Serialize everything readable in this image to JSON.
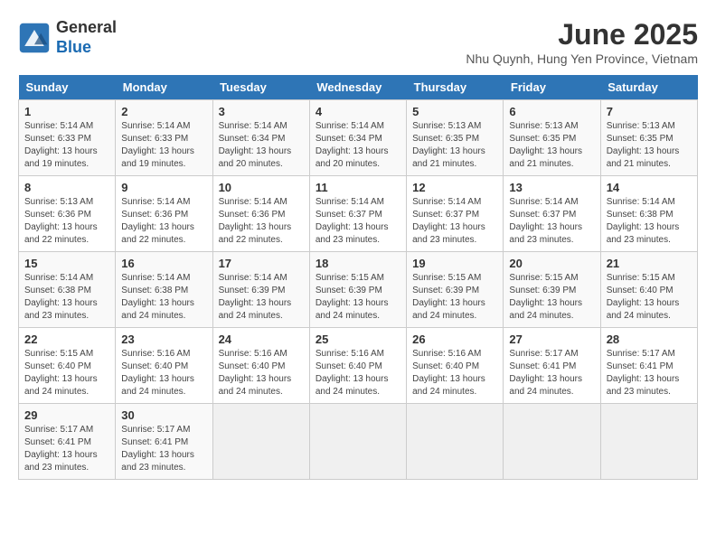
{
  "header": {
    "logo_line1": "General",
    "logo_line2": "Blue",
    "month_year": "June 2025",
    "location": "Nhu Quynh, Hung Yen Province, Vietnam"
  },
  "days_of_week": [
    "Sunday",
    "Monday",
    "Tuesday",
    "Wednesday",
    "Thursday",
    "Friday",
    "Saturday"
  ],
  "weeks": [
    [
      {
        "day": 1,
        "lines": [
          "Sunrise: 5:14 AM",
          "Sunset: 6:33 PM",
          "Daylight: 13 hours",
          "and 19 minutes."
        ]
      },
      {
        "day": 2,
        "lines": [
          "Sunrise: 5:14 AM",
          "Sunset: 6:33 PM",
          "Daylight: 13 hours",
          "and 19 minutes."
        ]
      },
      {
        "day": 3,
        "lines": [
          "Sunrise: 5:14 AM",
          "Sunset: 6:34 PM",
          "Daylight: 13 hours",
          "and 20 minutes."
        ]
      },
      {
        "day": 4,
        "lines": [
          "Sunrise: 5:14 AM",
          "Sunset: 6:34 PM",
          "Daylight: 13 hours",
          "and 20 minutes."
        ]
      },
      {
        "day": 5,
        "lines": [
          "Sunrise: 5:13 AM",
          "Sunset: 6:35 PM",
          "Daylight: 13 hours",
          "and 21 minutes."
        ]
      },
      {
        "day": 6,
        "lines": [
          "Sunrise: 5:13 AM",
          "Sunset: 6:35 PM",
          "Daylight: 13 hours",
          "and 21 minutes."
        ]
      },
      {
        "day": 7,
        "lines": [
          "Sunrise: 5:13 AM",
          "Sunset: 6:35 PM",
          "Daylight: 13 hours",
          "and 21 minutes."
        ]
      }
    ],
    [
      {
        "day": 8,
        "lines": [
          "Sunrise: 5:13 AM",
          "Sunset: 6:36 PM",
          "Daylight: 13 hours",
          "and 22 minutes."
        ]
      },
      {
        "day": 9,
        "lines": [
          "Sunrise: 5:14 AM",
          "Sunset: 6:36 PM",
          "Daylight: 13 hours",
          "and 22 minutes."
        ]
      },
      {
        "day": 10,
        "lines": [
          "Sunrise: 5:14 AM",
          "Sunset: 6:36 PM",
          "Daylight: 13 hours",
          "and 22 minutes."
        ]
      },
      {
        "day": 11,
        "lines": [
          "Sunrise: 5:14 AM",
          "Sunset: 6:37 PM",
          "Daylight: 13 hours",
          "and 23 minutes."
        ]
      },
      {
        "day": 12,
        "lines": [
          "Sunrise: 5:14 AM",
          "Sunset: 6:37 PM",
          "Daylight: 13 hours",
          "and 23 minutes."
        ]
      },
      {
        "day": 13,
        "lines": [
          "Sunrise: 5:14 AM",
          "Sunset: 6:37 PM",
          "Daylight: 13 hours",
          "and 23 minutes."
        ]
      },
      {
        "day": 14,
        "lines": [
          "Sunrise: 5:14 AM",
          "Sunset: 6:38 PM",
          "Daylight: 13 hours",
          "and 23 minutes."
        ]
      }
    ],
    [
      {
        "day": 15,
        "lines": [
          "Sunrise: 5:14 AM",
          "Sunset: 6:38 PM",
          "Daylight: 13 hours",
          "and 23 minutes."
        ]
      },
      {
        "day": 16,
        "lines": [
          "Sunrise: 5:14 AM",
          "Sunset: 6:38 PM",
          "Daylight: 13 hours",
          "and 24 minutes."
        ]
      },
      {
        "day": 17,
        "lines": [
          "Sunrise: 5:14 AM",
          "Sunset: 6:39 PM",
          "Daylight: 13 hours",
          "and 24 minutes."
        ]
      },
      {
        "day": 18,
        "lines": [
          "Sunrise: 5:15 AM",
          "Sunset: 6:39 PM",
          "Daylight: 13 hours",
          "and 24 minutes."
        ]
      },
      {
        "day": 19,
        "lines": [
          "Sunrise: 5:15 AM",
          "Sunset: 6:39 PM",
          "Daylight: 13 hours",
          "and 24 minutes."
        ]
      },
      {
        "day": 20,
        "lines": [
          "Sunrise: 5:15 AM",
          "Sunset: 6:39 PM",
          "Daylight: 13 hours",
          "and 24 minutes."
        ]
      },
      {
        "day": 21,
        "lines": [
          "Sunrise: 5:15 AM",
          "Sunset: 6:40 PM",
          "Daylight: 13 hours",
          "and 24 minutes."
        ]
      }
    ],
    [
      {
        "day": 22,
        "lines": [
          "Sunrise: 5:15 AM",
          "Sunset: 6:40 PM",
          "Daylight: 13 hours",
          "and 24 minutes."
        ]
      },
      {
        "day": 23,
        "lines": [
          "Sunrise: 5:16 AM",
          "Sunset: 6:40 PM",
          "Daylight: 13 hours",
          "and 24 minutes."
        ]
      },
      {
        "day": 24,
        "lines": [
          "Sunrise: 5:16 AM",
          "Sunset: 6:40 PM",
          "Daylight: 13 hours",
          "and 24 minutes."
        ]
      },
      {
        "day": 25,
        "lines": [
          "Sunrise: 5:16 AM",
          "Sunset: 6:40 PM",
          "Daylight: 13 hours",
          "and 24 minutes."
        ]
      },
      {
        "day": 26,
        "lines": [
          "Sunrise: 5:16 AM",
          "Sunset: 6:40 PM",
          "Daylight: 13 hours",
          "and 24 minutes."
        ]
      },
      {
        "day": 27,
        "lines": [
          "Sunrise: 5:17 AM",
          "Sunset: 6:41 PM",
          "Daylight: 13 hours",
          "and 24 minutes."
        ]
      },
      {
        "day": 28,
        "lines": [
          "Sunrise: 5:17 AM",
          "Sunset: 6:41 PM",
          "Daylight: 13 hours",
          "and 23 minutes."
        ]
      }
    ],
    [
      {
        "day": 29,
        "lines": [
          "Sunrise: 5:17 AM",
          "Sunset: 6:41 PM",
          "Daylight: 13 hours",
          "and 23 minutes."
        ]
      },
      {
        "day": 30,
        "lines": [
          "Sunrise: 5:17 AM",
          "Sunset: 6:41 PM",
          "Daylight: 13 hours",
          "and 23 minutes."
        ]
      },
      null,
      null,
      null,
      null,
      null
    ]
  ]
}
